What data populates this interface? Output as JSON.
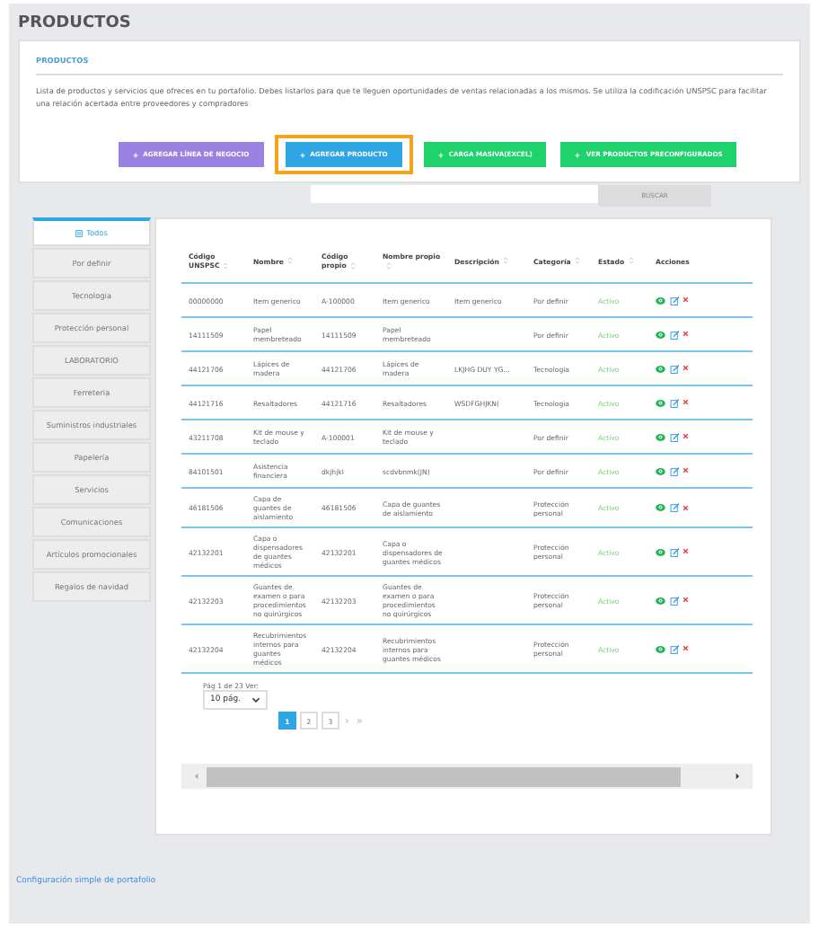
{
  "page_title": "PRODUCTOS",
  "section": {
    "title": "PRODUCTOS",
    "description": "Lista de productos y servicios que ofreces en tu portafolio. Debes listarlos para que te lleguen oportunidades de ventas relacionadas a los mismos. Se utiliza la codificación UNSPSC para facilitar una relación acertada entre proveedores y compradores",
    "buttons": [
      {
        "label": "AGREGAR LÍNEA DE NEGOCIO",
        "kind": "purple",
        "highlighted": false
      },
      {
        "label": "AGREGAR PRODUCTO",
        "kind": "blue",
        "highlighted": true
      },
      {
        "label": "CARGA MASIVA(EXCEL)",
        "kind": "green",
        "highlighted": false
      },
      {
        "label": "VER PRODUCTOS PRECONFIGURADOS",
        "kind": "green",
        "highlighted": false
      }
    ]
  },
  "search": {
    "button": "BUSCAR"
  },
  "sidebar": {
    "items": [
      {
        "label": "Todos",
        "selected": true
      },
      {
        "label": "Por definir",
        "selected": false
      },
      {
        "label": "Tecnologia",
        "selected": false
      },
      {
        "label": "Protección personal",
        "selected": false
      },
      {
        "label": "LABORATORIO",
        "selected": false
      },
      {
        "label": "Ferreteria",
        "selected": false
      },
      {
        "label": "Suministros industriales",
        "selected": false
      },
      {
        "label": "Papelería",
        "selected": false
      },
      {
        "label": "Servicios",
        "selected": false
      },
      {
        "label": "Comunicaciones",
        "selected": false
      },
      {
        "label": "Artículos promocionales",
        "selected": false
      },
      {
        "label": "Regalos de navidad",
        "selected": false
      }
    ]
  },
  "table": {
    "columns": [
      {
        "label": "Código UNSPSC",
        "sortable": true
      },
      {
        "label": "Nombre",
        "sortable": true
      },
      {
        "label": "Código propio",
        "sortable": true
      },
      {
        "label": "Nombre propio",
        "sortable": true
      },
      {
        "label": "Descripción",
        "sortable": true
      },
      {
        "label": "Categoría",
        "sortable": true
      },
      {
        "label": "Estado",
        "sortable": true
      },
      {
        "label": "Acciones",
        "sortable": false
      }
    ],
    "rows": [
      {
        "unspsc": "00000000",
        "nombre": "Item generico",
        "codigo": "A-100000",
        "nombre_propio": "Item generico",
        "descripcion": "Item generico",
        "categoria": "Por definir",
        "estado": "Activo"
      },
      {
        "unspsc": "14111509",
        "nombre": "Papel membreteado",
        "codigo": "14111509",
        "nombre_propio": "Papel membreteado",
        "descripcion": "",
        "categoria": "Por definir",
        "estado": "Activo"
      },
      {
        "unspsc": "44121706",
        "nombre": "Lápices de madera",
        "codigo": "44121706",
        "nombre_propio": "Lápices de madera",
        "descripcion": "LKJHG DUY YG...",
        "categoria": "Tecnologia",
        "estado": "Activo"
      },
      {
        "unspsc": "44121716",
        "nombre": "Resaltadores",
        "codigo": "44121716",
        "nombre_propio": "Resaltadores",
        "descripcion": "WSDFGHJKN(",
        "categoria": "Tecnologia",
        "estado": "Activo"
      },
      {
        "unspsc": "43211708",
        "nombre": "Kit de mouse y teclado",
        "codigo": "A-100001",
        "nombre_propio": "Kit de mouse y teclado",
        "descripcion": "",
        "categoria": "Por definir",
        "estado": "Activo"
      },
      {
        "unspsc": "84101501",
        "nombre": "Asistencia financiera",
        "codigo": "dkjhjkl",
        "nombre_propio": "scdvbnmk(JN)",
        "descripcion": "",
        "categoria": "Por definir",
        "estado": "Activo"
      },
      {
        "unspsc": "46181506",
        "nombre": "Capa de guantes de aislamiento",
        "codigo": "46181506",
        "nombre_propio": "Capa de guantes de aislamiento",
        "descripcion": "",
        "categoria": "Protección personal",
        "estado": "Activo"
      },
      {
        "unspsc": "42132201",
        "nombre": "Capa o dispensadores de guantes médicos",
        "codigo": "42132201",
        "nombre_propio": "Capa o dispensadores de guantes médicos",
        "descripcion": "",
        "categoria": "Protección personal",
        "estado": "Activo"
      },
      {
        "unspsc": "42132203",
        "nombre": "Guantes de examen o para procedimientos no quirúrgicos",
        "codigo": "42132203",
        "nombre_propio": "Guantes de examen o para procedimientos no quirúrgicos",
        "descripcion": "",
        "categoria": "Protección personal",
        "estado": "Activo"
      },
      {
        "unspsc": "42132204",
        "nombre": "Recubrimientos internos para guantes médicos",
        "codigo": "42132204",
        "nombre_propio": "Recubrimientos internos para guantes médicos",
        "descripcion": "",
        "categoria": "Protección personal",
        "estado": "Activo"
      }
    ]
  },
  "pagination": {
    "info": "Pág 1 de 23 Ver:",
    "page_size": "10 pág.",
    "pages": [
      {
        "label": "1",
        "selected": true
      },
      {
        "label": "2",
        "selected": false
      },
      {
        "label": "3",
        "selected": false
      }
    ],
    "next": "›",
    "last": "»"
  },
  "footer_link": "Configuración simple de portafolio"
}
